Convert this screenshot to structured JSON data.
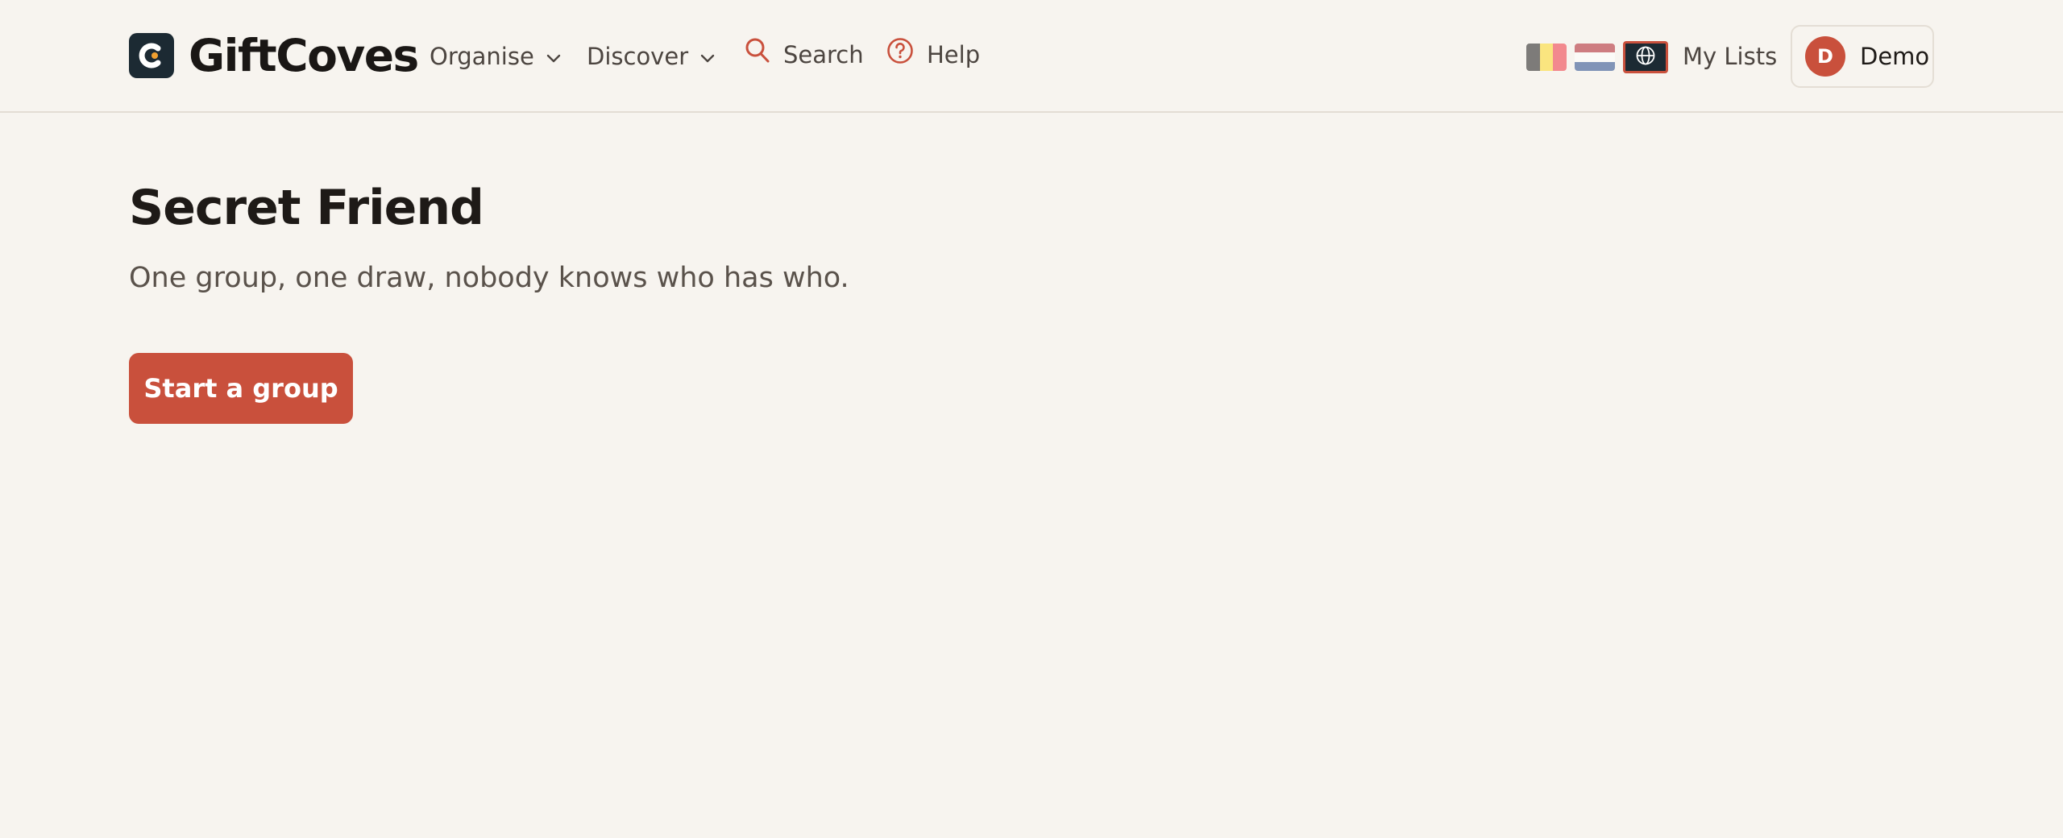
{
  "app": {
    "brand": "GiftCoves",
    "accent": "#c9503c",
    "background": "#f7f4ef",
    "logo_bg": "#1c2a33"
  },
  "nav": {
    "items": [
      {
        "label": "Organise",
        "icon": "chevron-down-icon"
      },
      {
        "label": "Discover",
        "icon": "chevron-down-icon"
      },
      {
        "label": "Search",
        "icon": "search-icon"
      },
      {
        "label": "Help",
        "icon": "help-circle-icon"
      }
    ],
    "languages": [
      {
        "code": "be",
        "colors": [
          "#1a1a1a",
          "#fdda24",
          "#ef3340"
        ],
        "selected": false
      },
      {
        "code": "nl",
        "colors": [
          "#ae1c28",
          "#ffffff",
          "#21468b"
        ],
        "selected": false
      },
      {
        "code": "global",
        "icon": "globe-icon",
        "selected": true
      }
    ],
    "my_lists": "My Lists",
    "user": {
      "initial": "D",
      "name": "Demo"
    }
  },
  "main": {
    "title": "Secret Friend",
    "subtitle": "One group, one draw, nobody knows who has who.",
    "cta_label": "Start a group"
  }
}
